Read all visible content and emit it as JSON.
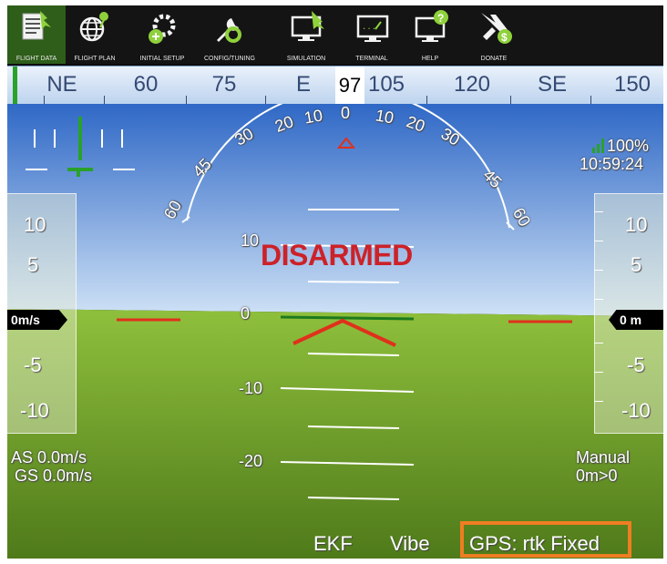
{
  "toolbar": {
    "items": [
      {
        "label": "FLIGHT DATA",
        "icon": "flight-data-icon"
      },
      {
        "label": "FLIGHT PLAN",
        "icon": "flight-plan-icon"
      },
      {
        "label": "INITIAL SETUP",
        "icon": "initial-setup-icon"
      },
      {
        "label": "CONFIG/TUNING",
        "icon": "config-tuning-icon"
      },
      {
        "label": "SIMULATION",
        "icon": "simulation-icon"
      },
      {
        "label": "TERMINAL",
        "icon": "terminal-icon"
      },
      {
        "label": "HELP",
        "icon": "help-icon"
      },
      {
        "label": "DONATE",
        "icon": "donate-icon"
      }
    ]
  },
  "compass": {
    "labels": [
      "NE",
      "60",
      "75",
      "E",
      "105",
      "120",
      "SE",
      "150"
    ],
    "current_heading": "97"
  },
  "hud": {
    "roll_scale": [
      "60",
      "45",
      "30",
      "20",
      "10",
      "0",
      "10",
      "20",
      "30",
      "45",
      "60"
    ],
    "pitch_labels": [
      "10",
      "0",
      "-10",
      "-20"
    ],
    "status_message": "DISARMED",
    "signal_percent": "100%",
    "clock": "10:59:24",
    "speed_tape": {
      "labels": [
        "10",
        "5",
        "-5",
        "-10"
      ],
      "readout": "0m/s"
    },
    "alt_tape": {
      "labels": [
        "10",
        "5",
        "-5",
        "-10"
      ],
      "readout": "0 m"
    },
    "airspeed": "AS 0.0m/s",
    "groundspeed": "GS 0.0m/s",
    "mode": "Manual",
    "distance": "0m>0",
    "status_bar": {
      "ekf": "EKF",
      "vibe": "Vibe",
      "gps": "GPS: rtk Fixed"
    }
  },
  "colors": {
    "sky_top": "#2f68c6",
    "sky_bottom": "#cfe2f6",
    "ground_top": "#8fc03c",
    "ground_bottom": "#4f7a1a",
    "disarmed": "#cc2228",
    "gps_highlight": "#ef7d22",
    "horizon_marker": "#e0301c"
  }
}
